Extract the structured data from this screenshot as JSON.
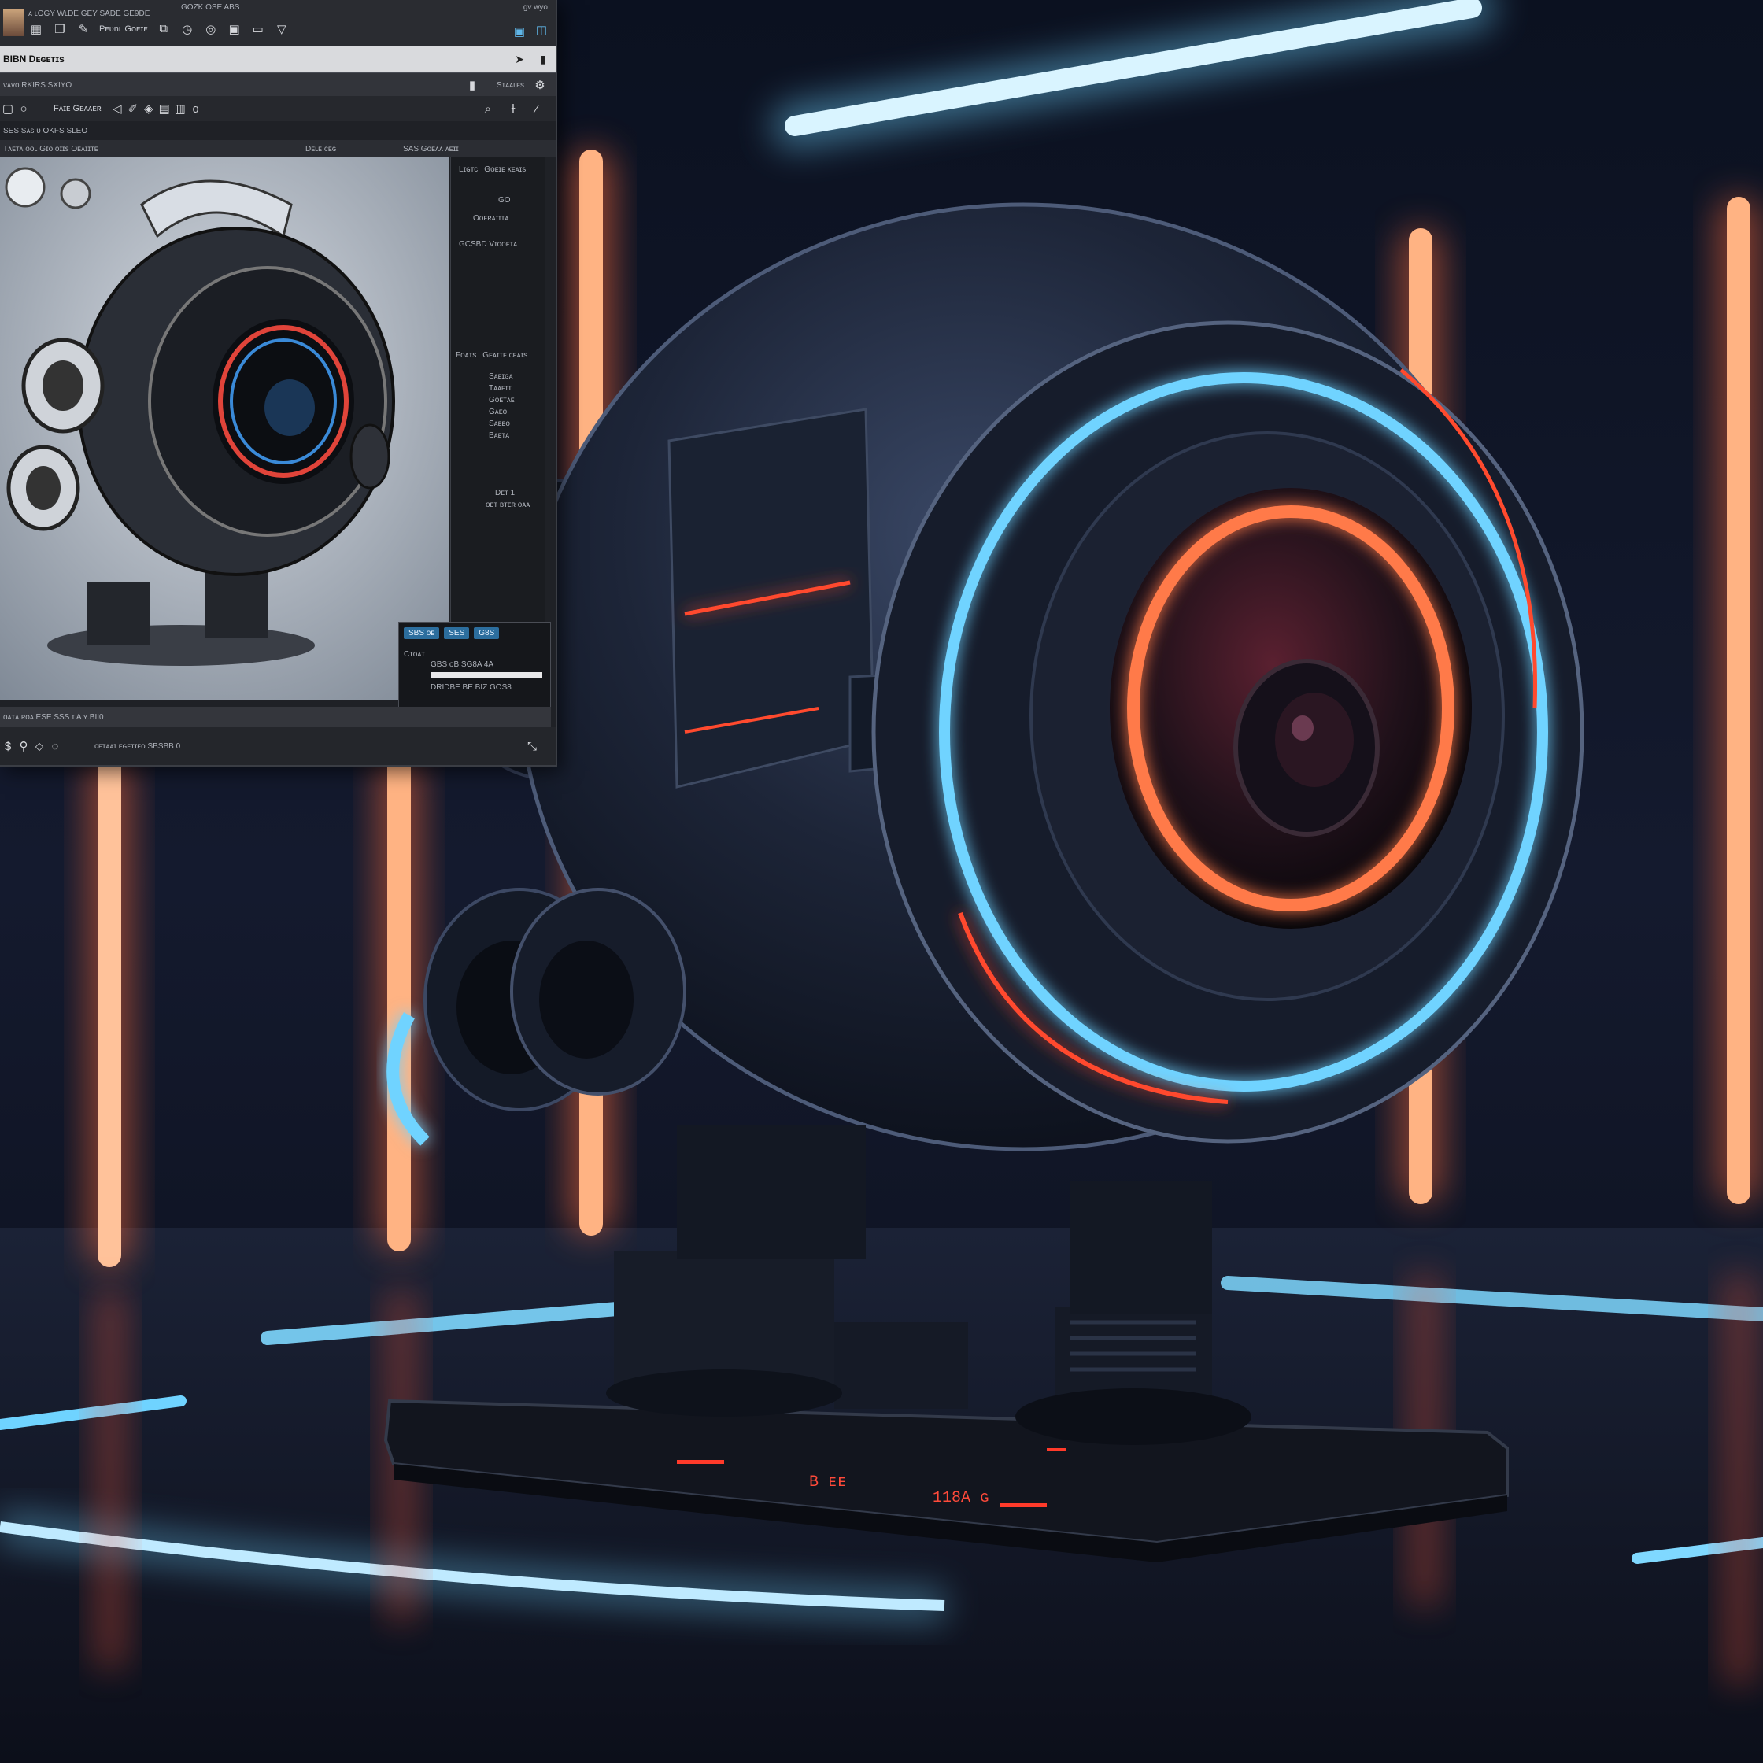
{
  "window": {
    "menu_text": "ᴀ ʟOGY WʟDE GEY SADE GE9DE",
    "menu_text_right": "GOZK OSE ABS",
    "corner_text": "gv wyo",
    "toolbar_label": "Pᴇᴜnʟ Gᴏᴇɪᴇ",
    "document_title": "BIBN Dᴇɢᴇᴛɪs",
    "layer_row": "ᴠᴀᴠᴏ RKIRS SXIYO",
    "layer_row_right": "Sᴛᴀᴀʟᴇs",
    "tool_text": "Fᴀɪᴇ Gᴇᴀᴀᴇʀ",
    "options_text": "SES Sᴀs ᴜ OKFS SLEO",
    "viewport_header": "Tᴀᴇᴛᴀ ᴏᴏʟ Gɪᴏ ᴏɪɪs Oᴇᴀɪɪᴛᴇ",
    "viewport_header_mid": "Dᴇʟᴇ ᴄᴇɢ",
    "viewport_header_right": "SAS Gᴏᴇᴀᴀ ᴀᴇɪɪ",
    "panel_header": "Lɪɢᴛᴄ",
    "panel_header_2": "Gᴏᴇɪᴇ ᴋᴇᴀɪs",
    "panel_item_1": "GO",
    "panel_item_2": "Oᴏᴇʀᴀɪɪᴛᴀ",
    "panel_item_3": "GCSBD Vɪᴏᴏᴇᴛᴀ",
    "panel_section": "Fᴏᴀᴛs",
    "panel_section_2": "Gᴇᴀɪᴛᴇ ᴄᴇᴀɪs",
    "panel_list": [
      "Sᴀᴇɪɢᴀ",
      "Tᴀᴀᴇɪᴛ",
      "Gᴏᴇᴛᴀᴇ",
      "Gᴀᴇᴏ",
      "Sᴀᴇᴇᴏ",
      "Bᴀᴇᴛᴀ"
    ],
    "panel_footer": "Dᴇᴛ 1",
    "panel_footer_2": "ᴏᴇᴛ ʙᴛᴇʀ ᴏᴀᴀ",
    "dialog_tab_1": "SBS ᴏᴇ",
    "dialog_tab_2": "SES",
    "dialog_tab_3": "G8S",
    "dialog_label": "Cᴛᴏᴀᴛ",
    "dialog_text_1": "GBS ᴏB SG8A 4A",
    "dialog_text_2": "DRIDBE BE BIZ GOS8",
    "status_text": "ᴏᴀᴛᴀ ʀᴏᴀ ESE SSS ɪ A ʏ.BII0",
    "status_text_2": "ᴄᴇᴛᴀᴀɪ ᴇɢᴇᴛɪᴇᴏ SBSBB 0"
  },
  "scene": {
    "base_label_1": "B ᴇᴇ",
    "base_label_2": "118A ɢ",
    "colors": {
      "neon_red": "#ff4a2e",
      "neon_orange": "#ffb27a",
      "neon_blue": "#6fd3ff",
      "body_dark": "#1a2233"
    }
  }
}
